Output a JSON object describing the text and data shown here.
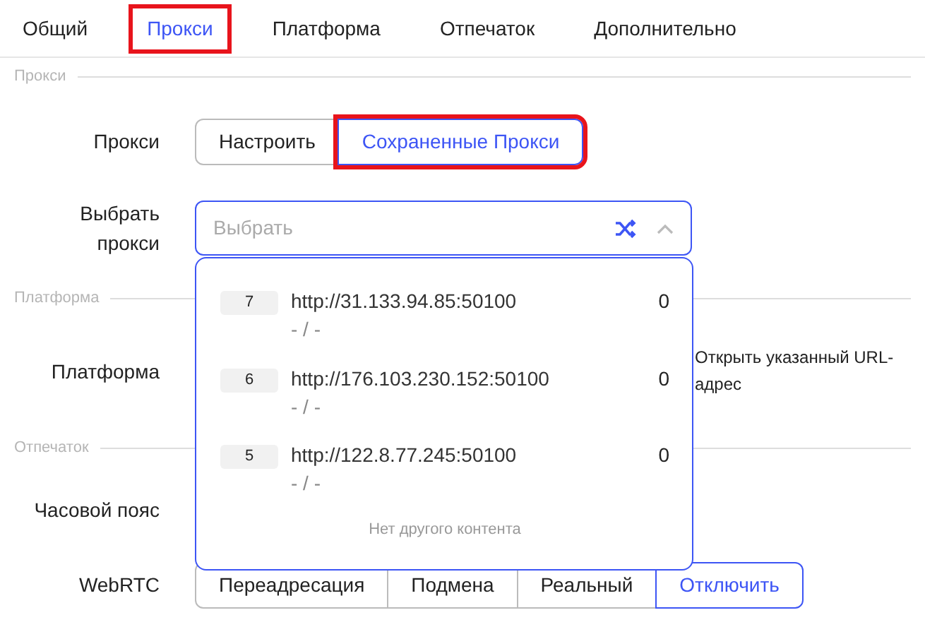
{
  "tabs": [
    {
      "label": "Общий",
      "selected": false,
      "highlighted": false
    },
    {
      "label": "Прокси",
      "selected": true,
      "highlighted": true
    },
    {
      "label": "Платформа",
      "selected": false,
      "highlighted": false
    },
    {
      "label": "Отпечаток",
      "selected": false,
      "highlighted": false
    },
    {
      "label": "Дополнительно",
      "selected": false,
      "highlighted": false
    }
  ],
  "sections": [
    {
      "title": "Прокси",
      "rows": [
        {
          "kind": "segmented",
          "label": "Прокси",
          "options": [
            {
              "label": "Настроить",
              "selected": false,
              "highlighted": false
            },
            {
              "label": "Сохраненные Прокси",
              "selected": true,
              "highlighted": true
            }
          ]
        },
        {
          "kind": "select",
          "label": "Выбрать прокси",
          "placeholder": "Выбрать",
          "expanded": true
        }
      ]
    },
    {
      "title": "Платформа",
      "rows": [
        {
          "kind": "note",
          "label": "Платформа",
          "note": "Открыть указанный URL-адрес"
        }
      ]
    },
    {
      "title": "Отпечаток",
      "rows": [
        {
          "kind": "empty",
          "label": "Часовой пояс"
        },
        {
          "kind": "segmented",
          "label": "WebRTC",
          "options": [
            {
              "label": "Переадресация",
              "selected": false,
              "highlighted": false
            },
            {
              "label": "Подмена",
              "selected": false,
              "highlighted": false
            },
            {
              "label": "Реальный",
              "selected": false,
              "highlighted": false
            },
            {
              "label": "Отключить",
              "selected": true,
              "highlighted": false
            }
          ]
        }
      ]
    }
  ],
  "dropdown": {
    "items": [
      {
        "number": "7",
        "url": "http://31.133.94.85:50100",
        "location": "- / -",
        "count": "0"
      },
      {
        "number": "6",
        "url": "http://176.103.230.152:50100",
        "location": "- / -",
        "count": "0"
      },
      {
        "number": "5",
        "url": "http://122.8.77.245:50100",
        "location": "- / -",
        "count": "0"
      }
    ],
    "footer": "Нет другого контента"
  }
}
